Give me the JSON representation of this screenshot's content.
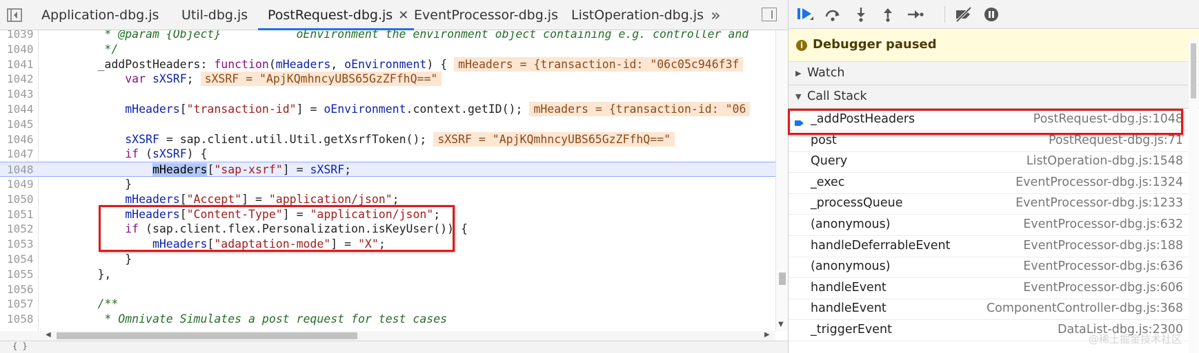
{
  "editor": {
    "tabs": [
      {
        "label": "Application-dbg.js",
        "active": false
      },
      {
        "label": "Util-dbg.js",
        "active": false
      },
      {
        "label": "PostRequest-dbg.js",
        "active": true
      },
      {
        "label": "EventProcessor-dbg.js",
        "active": false
      },
      {
        "label": "ListOperation-dbg.js",
        "active": false
      }
    ],
    "more_tabs": "»",
    "close_glyph": "✕",
    "lines": [
      {
        "n": "1039",
        "parts": [
          [
            "c-com",
            "         * @param {Object}           oEnvironment the environment object containing e.g. controller and"
          ]
        ]
      },
      {
        "n": "1040",
        "parts": [
          [
            "c-com",
            "         */"
          ]
        ]
      },
      {
        "n": "1041",
        "parts": [
          [
            "c-prop",
            "        _addPostHeaders: "
          ],
          [
            "c-kw",
            "function"
          ],
          [
            "c-prop",
            "("
          ],
          [
            "c-var",
            "mHeaders"
          ],
          [
            "c-prop",
            ", "
          ],
          [
            "c-var",
            "oEnvironment"
          ],
          [
            "c-prop",
            ") {"
          ],
          [
            "inline-val",
            "mHeaders = {transaction-id: \"06c05c946f3f"
          ]
        ]
      },
      {
        "n": "1042",
        "parts": [
          [
            "c-kw",
            "            var "
          ],
          [
            "c-var",
            "sXSRF"
          ],
          [
            "c-prop",
            ";"
          ],
          [
            "inline-val",
            "sXSRF = \"ApjKQmhncyUBS65GzZFfhQ==\""
          ]
        ]
      },
      {
        "n": "1043",
        "parts": []
      },
      {
        "n": "1044",
        "parts": [
          [
            "c-var",
            "            mHeaders"
          ],
          [
            "c-prop",
            "["
          ],
          [
            "c-str",
            "\"transaction-id\""
          ],
          [
            "c-prop",
            "] = "
          ],
          [
            "c-var",
            "oEnvironment"
          ],
          [
            "c-prop",
            ".context.getID();"
          ],
          [
            "inline-val",
            "mHeaders = {transaction-id: \"06"
          ]
        ]
      },
      {
        "n": "1045",
        "parts": []
      },
      {
        "n": "1046",
        "parts": [
          [
            "c-var",
            "            sXSRF"
          ],
          [
            "c-prop",
            " = sap.client.util.Util.getXsrfToken();"
          ],
          [
            "inline-val",
            "sXSRF = \"ApjKQmhncyUBS65GzZFfhQ==\""
          ]
        ]
      },
      {
        "n": "1047",
        "parts": [
          [
            "c-kw",
            "            if "
          ],
          [
            "c-prop",
            "("
          ],
          [
            "c-var",
            "sXSRF"
          ],
          [
            "c-prop",
            ") {"
          ]
        ]
      },
      {
        "n": "1048",
        "hl": true,
        "parts": [
          [
            "c-prop",
            "                "
          ],
          [
            "c-sel",
            "mHeaders"
          ],
          [
            "c-prop",
            "["
          ],
          [
            "c-str",
            "\"sap-xsrf\""
          ],
          [
            "c-prop",
            "] = "
          ],
          [
            "c-var",
            "sXSRF"
          ],
          [
            "c-prop",
            ";"
          ]
        ]
      },
      {
        "n": "1049",
        "parts": [
          [
            "c-prop",
            "            }"
          ]
        ]
      },
      {
        "n": "1050",
        "parts": [
          [
            "c-var",
            "            mHeaders"
          ],
          [
            "c-prop",
            "["
          ],
          [
            "c-str",
            "\"Accept\""
          ],
          [
            "c-prop",
            "] = "
          ],
          [
            "c-str",
            "\"application/json\""
          ],
          [
            "c-prop",
            ";"
          ]
        ]
      },
      {
        "n": "1051",
        "parts": [
          [
            "c-var",
            "            mHeaders"
          ],
          [
            "c-prop",
            "["
          ],
          [
            "c-str",
            "\"Content-Type\""
          ],
          [
            "c-prop",
            "] = "
          ],
          [
            "c-str",
            "\"application/json\""
          ],
          [
            "c-prop",
            ";"
          ]
        ]
      },
      {
        "n": "1052",
        "parts": [
          [
            "c-kw",
            "            if "
          ],
          [
            "c-prop",
            "(sap.client.flex.Personalization.isKeyUser()) {"
          ]
        ]
      },
      {
        "n": "1053",
        "parts": [
          [
            "c-var",
            "                mHeaders"
          ],
          [
            "c-prop",
            "["
          ],
          [
            "c-str",
            "\"adaptation-mode\""
          ],
          [
            "c-prop",
            "] = "
          ],
          [
            "c-str",
            "\"X\""
          ],
          [
            "c-prop",
            ";"
          ]
        ]
      },
      {
        "n": "1054",
        "parts": [
          [
            "c-prop",
            "            }"
          ]
        ]
      },
      {
        "n": "1055",
        "parts": [
          [
            "c-prop",
            "        },"
          ]
        ]
      },
      {
        "n": "1056",
        "parts": []
      },
      {
        "n": "1057",
        "parts": [
          [
            "c-com",
            "        /**"
          ]
        ]
      },
      {
        "n": "1058",
        "parts": [
          [
            "c-com",
            "         * Omnivate Simulates a post request for test cases"
          ]
        ]
      }
    ]
  },
  "debugger": {
    "paused_text": "Debugger paused",
    "watch_label": "Watch",
    "callstack_label": "Call Stack",
    "frames": [
      {
        "name": "_addPostHeaders",
        "loc": "PostRequest-dbg.js:1048",
        "current": true
      },
      {
        "name": "post",
        "loc": "PostRequest-dbg.js:71"
      },
      {
        "name": "Query",
        "loc": "ListOperation-dbg.js:1548"
      },
      {
        "name": "_exec",
        "loc": "EventProcessor-dbg.js:1324"
      },
      {
        "name": "_processQueue",
        "loc": "EventProcessor-dbg.js:1233"
      },
      {
        "name": "(anonymous)",
        "loc": "EventProcessor-dbg.js:632"
      },
      {
        "name": "handleDeferrableEvent",
        "loc": "EventProcessor-dbg.js:188"
      },
      {
        "name": "(anonymous)",
        "loc": "EventProcessor-dbg.js:636"
      },
      {
        "name": "handleEvent",
        "loc": "EventProcessor-dbg.js:606"
      },
      {
        "name": "handleEvent",
        "loc": "ComponentController-dbg.js:368"
      },
      {
        "name": "_triggerEvent",
        "loc": "DataList-dbg.js:2300"
      }
    ],
    "watermark": "@稀土掘金技术社区"
  },
  "statusbar": {
    "text": "{ }"
  },
  "colors": {
    "accent": "#1a73e8",
    "highlight_border": "#e0191b",
    "paused_bg": "#fffbdb"
  }
}
